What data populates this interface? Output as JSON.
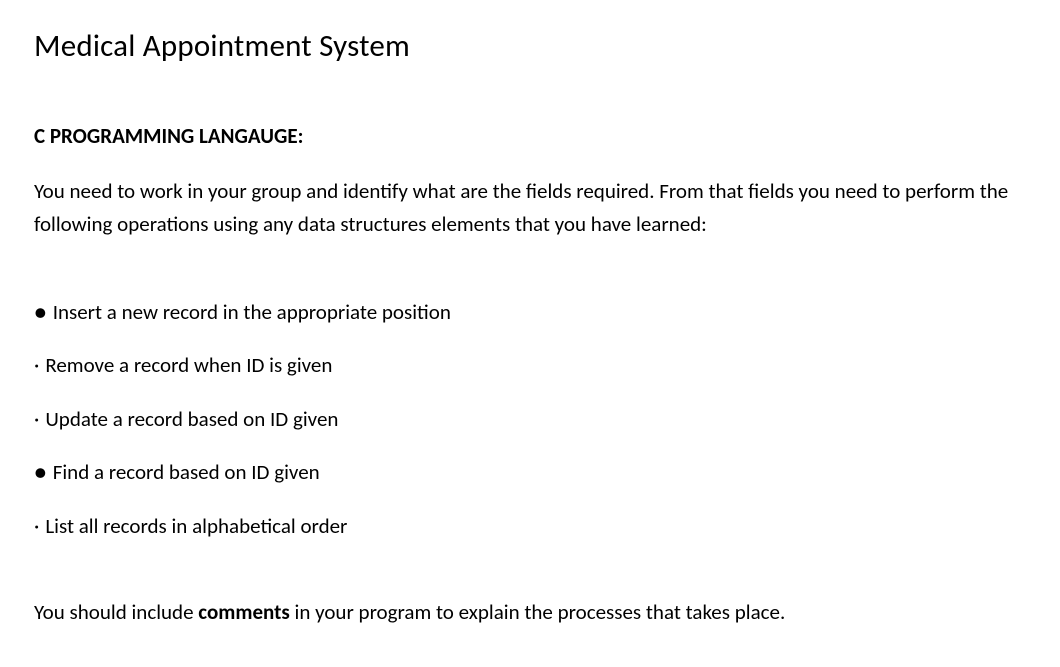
{
  "title": "Medical Appointment System",
  "subheading": "C PROGRAMMING LANGAUGE:",
  "intro": "You need to work in your group and identify what are the fields required. From that fields you need to perform the following operations using any data structures elements that you have learned:",
  "list_items": [
    {
      "bullet": "●",
      "text": "Insert a new record in the appropriate position"
    },
    {
      "bullet": "·",
      "text": "Remove a record when ID is given"
    },
    {
      "bullet": "·",
      "text": "Update a record based on ID given"
    },
    {
      "bullet": "●",
      "text": "Find a record based on ID given"
    },
    {
      "bullet": "·",
      "text": "List all records in alphabetical order"
    }
  ],
  "closing_prefix": "You should include ",
  "closing_bold": "comments",
  "closing_suffix": " in your program to explain the processes that takes place."
}
